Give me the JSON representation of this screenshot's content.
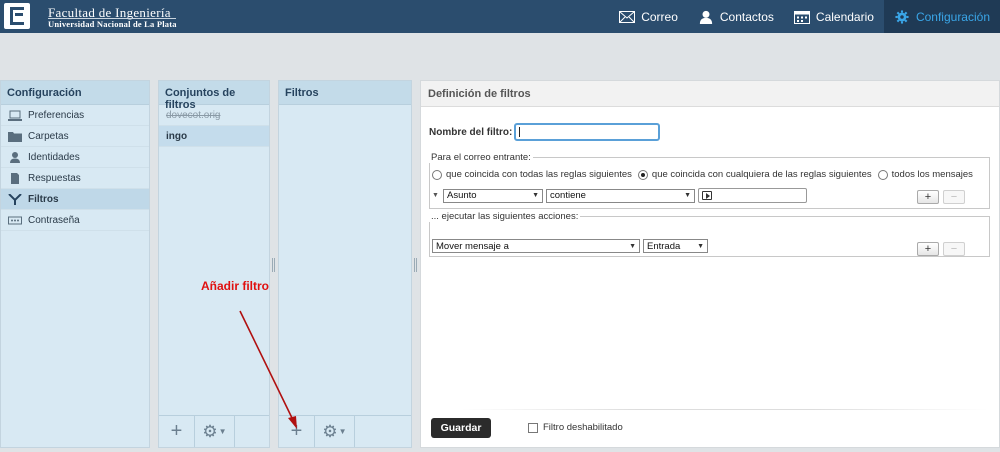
{
  "header": {
    "org_name": "Facultad de Ingeniería",
    "org_sub": "Universidad Nacional de La Plata",
    "nav": [
      {
        "label": "Correo",
        "icon": "mail-icon"
      },
      {
        "label": "Contactos",
        "icon": "contacts-icon"
      },
      {
        "label": "Calendario",
        "icon": "calendar-icon"
      },
      {
        "label": "Configuración",
        "icon": "gear-icon",
        "active": true
      }
    ]
  },
  "config_panel": {
    "title": "Configuración",
    "items": [
      {
        "label": "Preferencias",
        "icon": "laptop-icon"
      },
      {
        "label": "Carpetas",
        "icon": "folder-icon"
      },
      {
        "label": "Identidades",
        "icon": "user-icon"
      },
      {
        "label": "Respuestas",
        "icon": "document-icon"
      },
      {
        "label": "Filtros",
        "icon": "filter-icon",
        "selected": true
      },
      {
        "label": "Contraseña",
        "icon": "password-icon"
      }
    ]
  },
  "sets_panel": {
    "title": "Conjuntos de filtros",
    "items": [
      {
        "label": "dovecot.orig",
        "disabled": true
      },
      {
        "label": "ingo",
        "selected": true
      }
    ]
  },
  "filters_panel": {
    "title": "Filtros"
  },
  "definition": {
    "title": "Definición de filtros",
    "name_label": "Nombre del filtro:",
    "name_value": "",
    "incoming_legend": "Para el correo entrante:",
    "match_options": [
      {
        "label": "que coincida con todas las reglas siguientes",
        "checked": false
      },
      {
        "label": "que coincida con cualquiera de las reglas siguientes",
        "checked": true
      },
      {
        "label": "todos los mensajes",
        "checked": false
      }
    ],
    "rule": {
      "header": "Asunto",
      "operator": "contiene",
      "value": ""
    },
    "actions_legend": "... ejecutar las siguientes acciones:",
    "action": {
      "type": "Mover mensaje a",
      "folder": "Entrada"
    },
    "add_label": "+",
    "remove_label": "−",
    "save_label": "Guardar",
    "disabled_label": "Filtro deshabilitado"
  },
  "annotation": {
    "text": "Añadir filtro",
    "color": "#e01010"
  },
  "colors": {
    "topbar": "#2b4d6e",
    "active_nav": "#3aa6e8",
    "panel_bg": "#d8e9f3"
  }
}
